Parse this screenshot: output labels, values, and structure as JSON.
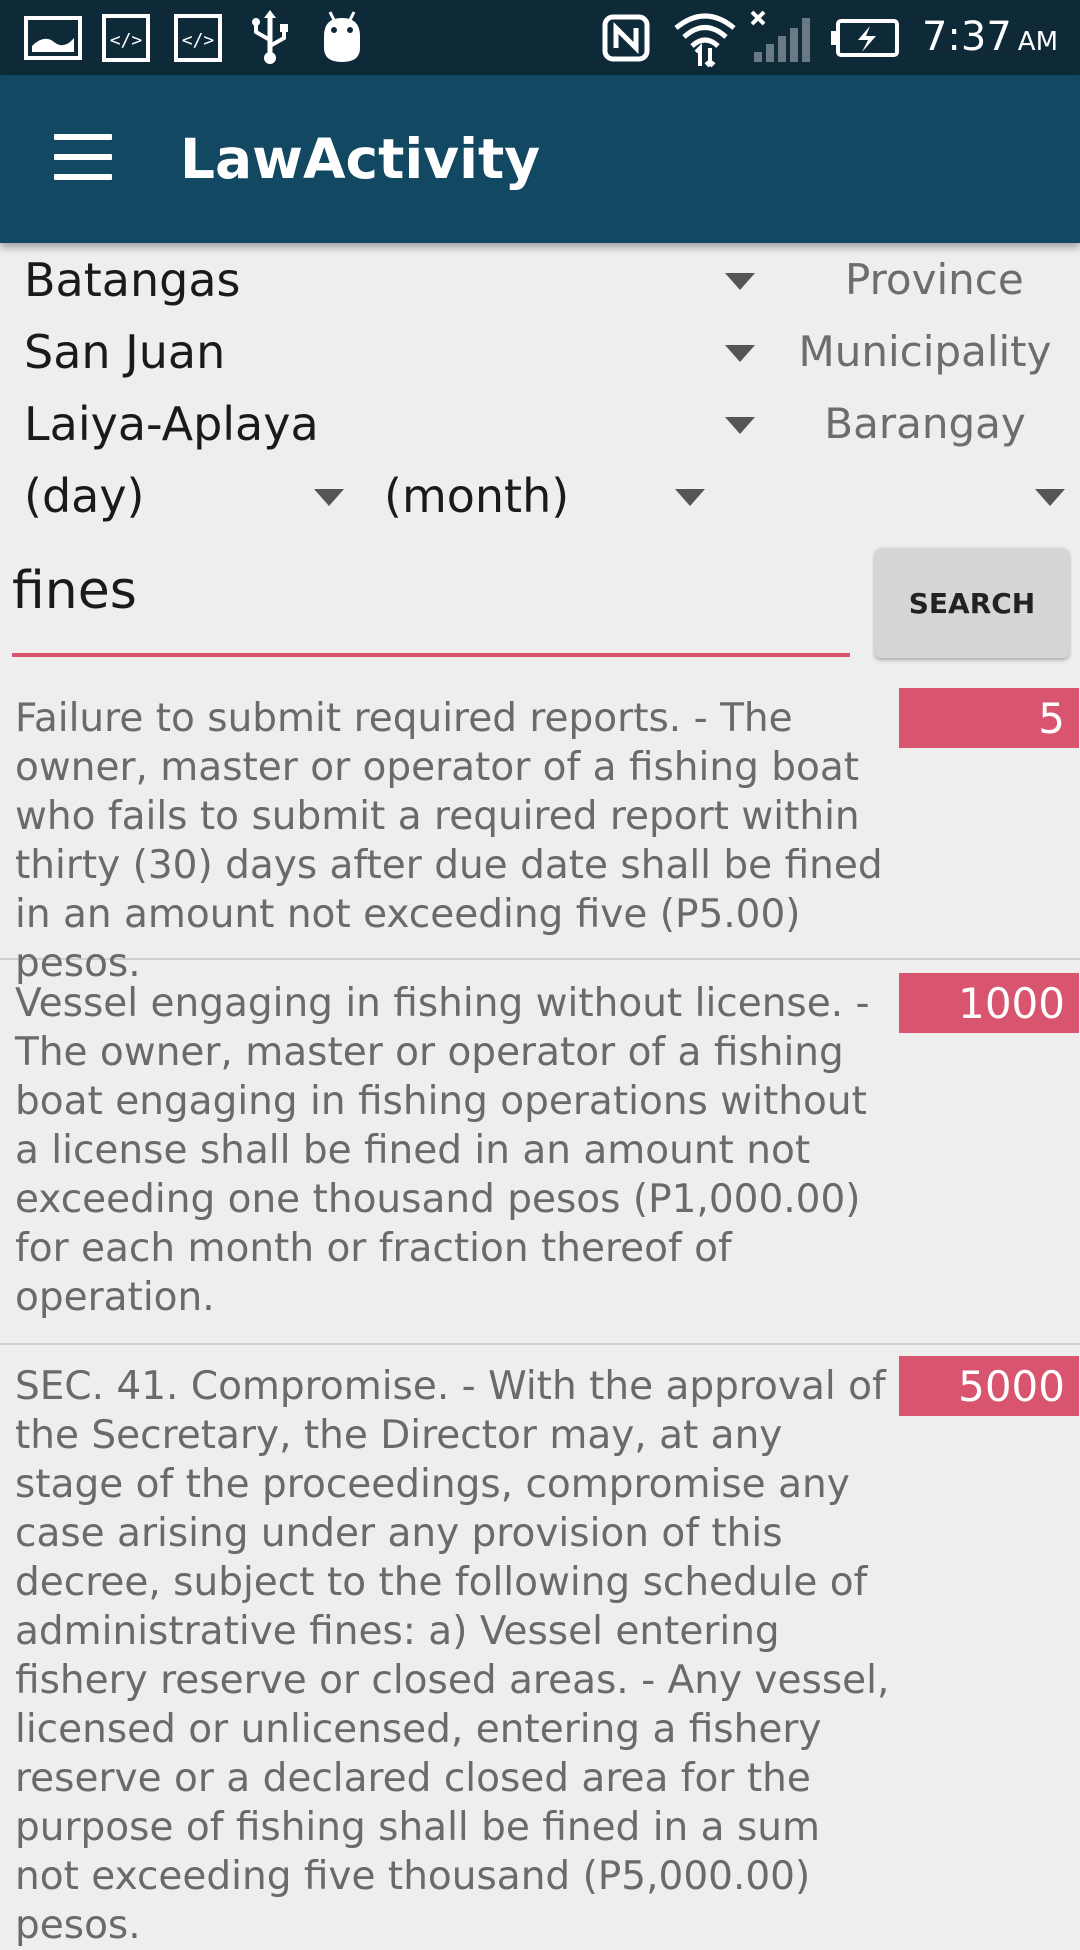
{
  "status_bar": {
    "time": "7:37",
    "ampm": "AM",
    "icons": [
      "image-icon",
      "code-icon",
      "code-icon",
      "usb-icon",
      "android-icon",
      "nfc-icon",
      "wifi-icon",
      "signal-icon",
      "battery-charging-icon"
    ]
  },
  "app_bar": {
    "title": "LawActivity",
    "menu_icon": "menu-icon"
  },
  "filters": {
    "province": {
      "value": "Batangas",
      "label": "Province"
    },
    "municipality": {
      "value": "San Juan",
      "label": "Municipality"
    },
    "barangay": {
      "value": "Laiya-Aplaya",
      "label": "Barangay"
    },
    "day": {
      "value": "(day)"
    },
    "month": {
      "value": "(month)"
    },
    "year": {
      "value": ""
    }
  },
  "search": {
    "value": "fines",
    "button_label": "SEARCH"
  },
  "results": [
    {
      "text": "Failure to submit required reports. - The owner, master or operator of a fishing boat who fails to submit a required report within thirty (30) days after due date shall be fined in an amount not exceeding five (P5.00) pesos.",
      "amount": "5"
    },
    {
      "text": "Vessel engaging in fishing without license. - The owner, master or operator of a fishing boat engaging in fishing operations without a license shall be fined in an amount not exceeding one thousand pesos (P1,000.00) for each month or fraction thereof of operation.",
      "amount": "1000"
    },
    {
      "text": "SEC. 41.  Compromise. - With the approval of the Secretary, the Director may, at any stage of the proceedings, compromise any case arising under any provision of this decree, subject to the following schedule of administrative fines: a) Vessel entering fishery reserve or closed areas. - Any vessel, licensed or unlicensed, entering a fishery reserve or a declared closed area for the purpose of fishing shall be fined in a sum not exceeding five thousand (P5,000.00) pesos.",
      "amount": "5000"
    }
  ],
  "colors": {
    "status_bar": "#0e2a38",
    "app_bar": "#124861",
    "accent": "#d9546f",
    "background": "#eeeeee"
  }
}
